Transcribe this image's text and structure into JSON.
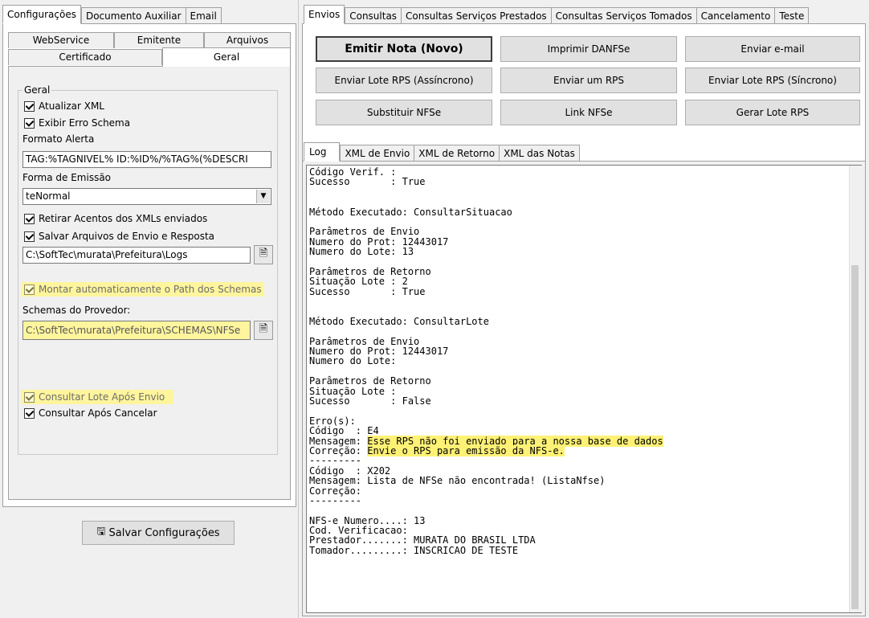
{
  "left_tabs": [
    "Configurações",
    "Documento Auxiliar",
    "Email"
  ],
  "config_subtabs_row1": [
    "WebService",
    "Emitente",
    "Arquivos"
  ],
  "config_subtabs_row2": [
    "Certificado",
    "Geral"
  ],
  "geral": {
    "group_label": "Geral",
    "atualizar_xml": "Atualizar XML",
    "exibir_erro_schema": "Exibir Erro Schema",
    "formato_alerta_label": "Formato Alerta",
    "formato_alerta_value": "TAG:%TAGNIVEL% ID:%ID%/%TAG%(%DESCRI",
    "forma_emissao_label": "Forma de Emissão",
    "forma_emissao_value": "teNormal",
    "retirar_acentos": "Retirar Acentos dos XMLs enviados",
    "salvar_arquivos": "Salvar Arquivos de Envio e Resposta",
    "logs_path": "C:\\SoftTec\\murata\\Prefeitura\\Logs",
    "montar_path": "Montar automaticamente o Path dos Schemas",
    "schemas_label": "Schemas do Provedor:",
    "schemas_path": "C:\\SoftTec\\murata\\Prefeitura\\SCHEMAS\\NFSe",
    "consultar_lote": "Consultar Lote Após Envio",
    "consultar_cancelar": "Consultar Após Cancelar"
  },
  "salvar_button": "Salvar Configurações",
  "right_tabs": [
    "Envios",
    "Consultas",
    "Consultas Serviços Prestados",
    "Consultas Serviços Tomados",
    "Cancelamento",
    "Teste"
  ],
  "actions": {
    "emitir": "Emitir Nota (Novo)",
    "imprimir": "Imprimir DANFSe",
    "enviar_email": "Enviar e-mail",
    "lote_assincrono": "Enviar Lote RPS (Assíncrono)",
    "enviar_rps": "Enviar um RPS",
    "lote_sincrono": "Enviar Lote RPS (Síncrono)",
    "substituir": "Substituir NFSe",
    "link": "Link NFSe",
    "gerar_lote": "Gerar Lote RPS"
  },
  "log_tabs": [
    "Log",
    "XML de Envio",
    "XML de Retorno",
    "XML das Notas"
  ],
  "log_lines": [
    "Código Verif. :",
    "Sucesso       : True",
    "",
    "",
    "Método Executado: ConsultarSituacao",
    "",
    "Parâmetros de Envio",
    "Numero do Prot: 12443017",
    "Numero do Lote: 13",
    "",
    "Parâmetros de Retorno",
    "Situação Lote : 2",
    "Sucesso       : True",
    "",
    "",
    "Método Executado: ConsultarLote",
    "",
    "Parâmetros de Envio",
    "Numero do Prot: 12443017",
    "Numero do Lote:",
    "",
    "Parâmetros de Retorno",
    "Situação Lote :",
    "Sucesso       : False",
    "",
    "Erro(s):",
    "Código  : E4",
    "Mensagem: Esse RPS não foi enviado para a nossa base de dados",
    "Correção: Envie o RPS para emissão da NFS-e.",
    "---------",
    "Código  : X202",
    "Mensagem: Lista de NFSe não encontrada! (ListaNfse)",
    "Correção:",
    "---------",
    "",
    "NFS-e Numero....: 13",
    "Cod. Verificacao:",
    "Prestador.......: MURATA DO BRASIL LTDA",
    "Tomador.........: INSCRICAO DE TESTE"
  ]
}
